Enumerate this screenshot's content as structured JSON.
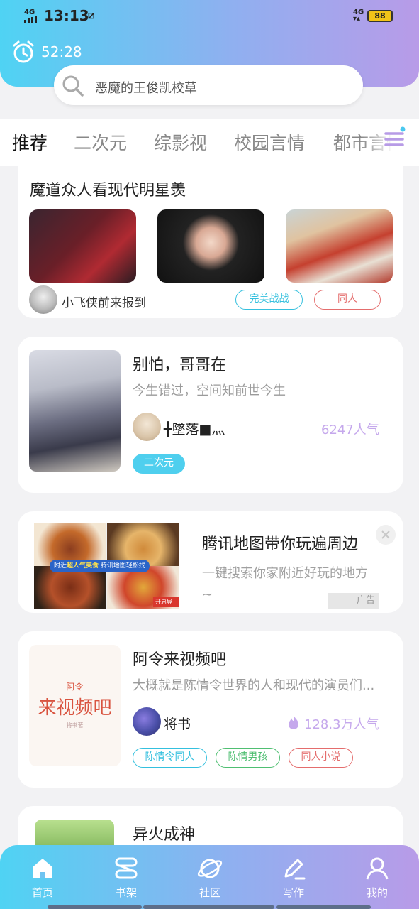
{
  "status_bar": {
    "network": "4G",
    "time": "13:13",
    "sim_icon": "sim-icon",
    "right_network": "4G",
    "battery": "88"
  },
  "timer": {
    "icon": "alarm-clock-icon",
    "value": "52:28"
  },
  "search": {
    "placeholder": "恶魔的王俊凯校草"
  },
  "tabs": [
    {
      "label": "推荐",
      "active": true
    },
    {
      "label": "二次元"
    },
    {
      "label": "综影视"
    },
    {
      "label": "校园言情"
    },
    {
      "label": "都市言情"
    }
  ],
  "topic_card": {
    "title": "魔道众人看现代明星羡",
    "author": "小飞侠前来报到",
    "tags": [
      "完美战战",
      "同人"
    ]
  },
  "story1": {
    "title": "别怕，哥哥在",
    "desc": "今生错过，空间知前世今生",
    "author": "╋墜落■灬",
    "popularity": "6247人气",
    "tag": "二次元"
  },
  "ad": {
    "title": "腾讯地图带你玩遍周边",
    "desc": "一键搜索你家附近好玩的地方~",
    "banner_prefix": "附近",
    "banner_highlight": "超人气美食",
    "banner_suffix": " 腾讯地图轻松找",
    "corner_tag": "开启导航",
    "label": "广告"
  },
  "story2": {
    "title": "阿令来视频吧",
    "desc": "大概就是陈情令世界的人和现代的演员们...",
    "cover_top": "阿令",
    "cover_text": "来视频吧",
    "cover_sub": "将书著",
    "author": "将书",
    "popularity": "128.3万人气",
    "tags": [
      "陈情令同人",
      "陈情男孩",
      "同人小说"
    ]
  },
  "story3": {
    "title": "异火成神"
  },
  "bottom_nav": [
    {
      "label": "首页",
      "icon": "home-icon"
    },
    {
      "label": "书架",
      "icon": "bookshelf-icon"
    },
    {
      "label": "社区",
      "icon": "planet-icon"
    },
    {
      "label": "写作",
      "icon": "pen-icon"
    },
    {
      "label": "我的",
      "icon": "user-icon"
    }
  ],
  "colors": {
    "accent_cyan": "#4fd3f3",
    "accent_purple": "#b89be8",
    "popularity": "#c5a8ec"
  }
}
